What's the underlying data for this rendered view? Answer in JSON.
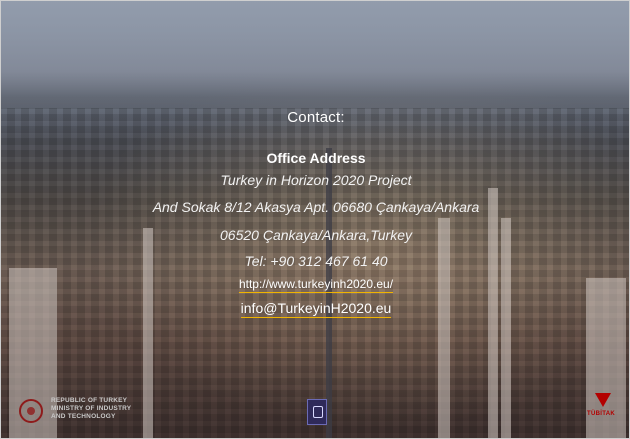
{
  "contact_title": "Contact:",
  "office_address_heading": "Office Address",
  "address_lines": [
    "Turkey in Horizon 2020 Project",
    "And Sokak 8/12 Akasya Apt. 06680 Çankaya/Ankara",
    "06520 Çankaya/Ankara,Turkey",
    "Tel: +90 312 467 61 40"
  ],
  "website": "http://www.turkeyinh2020.eu/",
  "email": "info@TurkeyinH2020.eu",
  "footer": {
    "ministry_logo_text": [
      "REPUBLIC OF TURKEY",
      "MINISTRY OF INDUSTRY",
      "AND TECHNOLOGY"
    ],
    "tubitak_logo_text": "TÜBİTAK"
  },
  "colors": {
    "link_underline": "#f0b400",
    "tubitak_red": "#b30000"
  }
}
